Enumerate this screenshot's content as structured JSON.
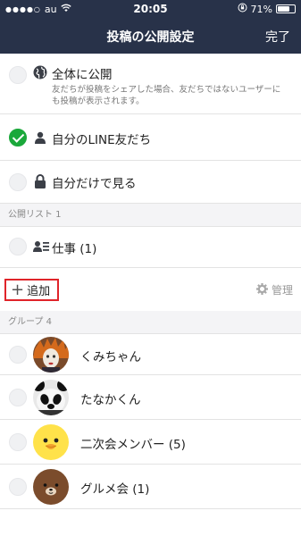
{
  "status_bar": {
    "carrier": "au",
    "time": "20:05",
    "battery": "71%",
    "battery_level": 0.71
  },
  "header": {
    "title": "投稿の公開設定",
    "done_label": "完了"
  },
  "options": {
    "public": {
      "label": "全体に公開",
      "description": "友だちが投稿をシェアした場合、友だちではないユーザーにも投稿が表示されます。",
      "selected": false
    },
    "friends": {
      "label": "自分のLINE友だち",
      "selected": true
    },
    "private": {
      "label": "自分だけで見る",
      "selected": false
    }
  },
  "public_lists": {
    "header": "公開リスト 1",
    "items": [
      {
        "label": "仕事 (1)"
      }
    ]
  },
  "actions": {
    "add_label": "追加",
    "manage_label": "管理"
  },
  "groups": {
    "header": "グループ 4",
    "items": [
      {
        "name": "くみちゃん"
      },
      {
        "name": "たなかくん"
      },
      {
        "name": "二次会メンバー (5)"
      },
      {
        "name": "グルメ会 (1)"
      }
    ]
  },
  "colors": {
    "header_bg": "#283249",
    "check_green": "#1aa83a",
    "highlight_red": "#e0242a"
  }
}
